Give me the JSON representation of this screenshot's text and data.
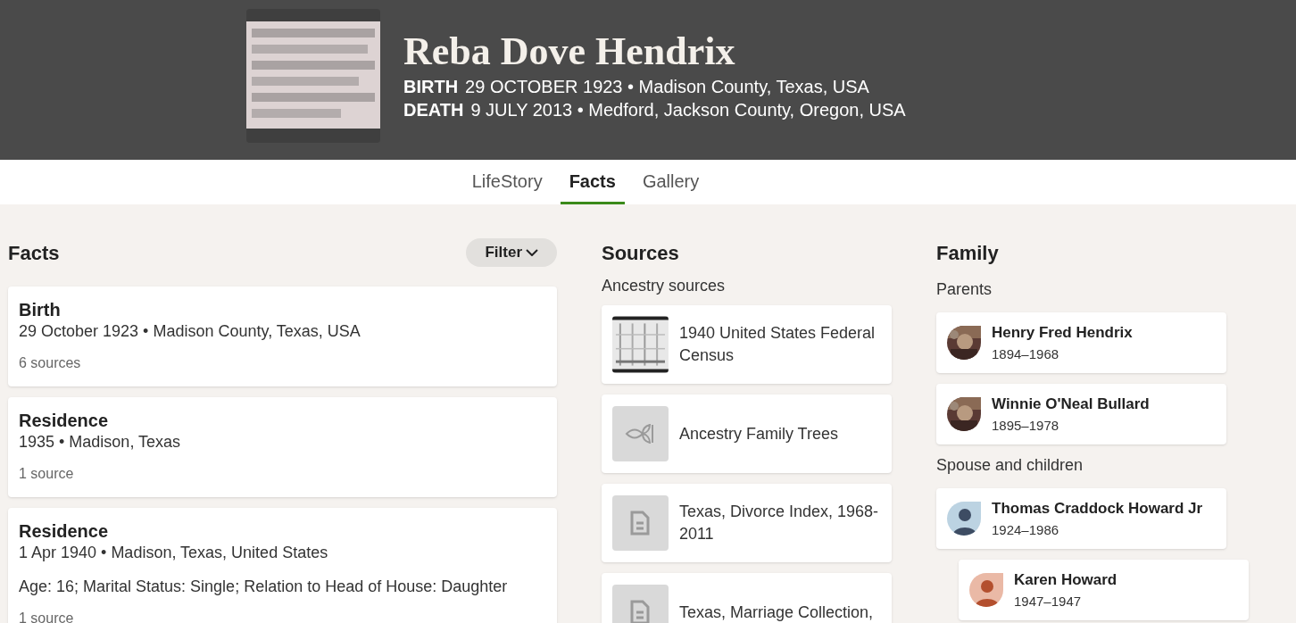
{
  "header": {
    "name": "Reba Dove Hendrix",
    "events": [
      {
        "label": "BIRTH",
        "value": "29 OCTOBER 1923 • Madison County, Texas, USA"
      },
      {
        "label": "DEATH",
        "value": "9 JULY 2013 • Medford, Jackson County, Oregon, USA"
      }
    ]
  },
  "tabs": [
    {
      "label": "LifeStory",
      "selected": false
    },
    {
      "label": "Facts",
      "selected": true
    },
    {
      "label": "Gallery",
      "selected": false
    }
  ],
  "facts": {
    "title": "Facts",
    "filter": "Filter",
    "items": [
      {
        "title": "Birth",
        "summary": "29 October 1923 • Madison County, Texas, USA",
        "sources": "6 sources"
      },
      {
        "title": "Residence",
        "summary": "1935 • Madison, Texas",
        "sources": "1 source"
      },
      {
        "title": "Residence",
        "summary": "1 Apr 1940 • Madison, Texas, United States",
        "detail": "Age: 16; Marital Status: Single; Relation to Head of House: Daughter",
        "sources": "1 source"
      }
    ]
  },
  "sources": {
    "title": "Sources",
    "subtitle": "Ancestry sources",
    "items": [
      {
        "kind": "picture",
        "label": "1940 United States Federal Census"
      },
      {
        "kind": "tree",
        "label": "Ancestry Family Trees"
      },
      {
        "kind": "document",
        "label": "Texas, Divorce Index, 1968-2011"
      },
      {
        "kind": "document",
        "label": "Texas, Marriage Collection,"
      }
    ]
  },
  "family": {
    "title": "Family",
    "groups": [
      {
        "label": "Parents",
        "members": [
          {
            "kind": "picture",
            "name": "Henry Fred Hendrix",
            "years": "1894–1968"
          },
          {
            "kind": "picture",
            "name": "Winnie O'Neal Bullard",
            "years": "1895–1978"
          }
        ]
      },
      {
        "label": "Spouse and children",
        "members": [
          {
            "kind": "male",
            "name": "Thomas Craddock Howard Jr",
            "years": "1924–1986",
            "children": [
              {
                "kind": "female",
                "name": "Karen Howard",
                "years": "1947–1947"
              }
            ]
          }
        ]
      }
    ]
  }
}
